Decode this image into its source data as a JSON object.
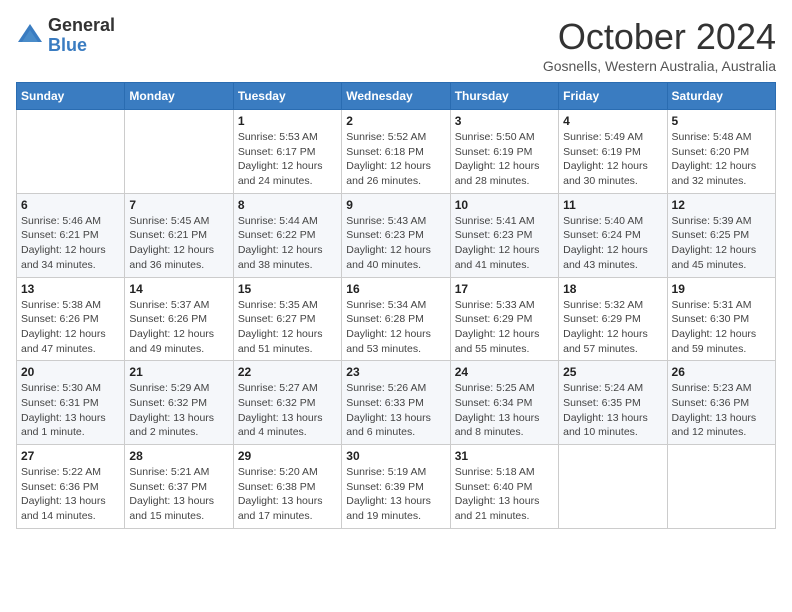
{
  "header": {
    "logo": {
      "general": "General",
      "blue": "Blue"
    },
    "title": "October 2024",
    "subtitle": "Gosnells, Western Australia, Australia"
  },
  "weekdays": [
    "Sunday",
    "Monday",
    "Tuesday",
    "Wednesday",
    "Thursday",
    "Friday",
    "Saturday"
  ],
  "weeks": [
    [
      {
        "day": "",
        "info": ""
      },
      {
        "day": "",
        "info": ""
      },
      {
        "day": "1",
        "info": "Sunrise: 5:53 AM\nSunset: 6:17 PM\nDaylight: 12 hours and 24 minutes."
      },
      {
        "day": "2",
        "info": "Sunrise: 5:52 AM\nSunset: 6:18 PM\nDaylight: 12 hours and 26 minutes."
      },
      {
        "day": "3",
        "info": "Sunrise: 5:50 AM\nSunset: 6:19 PM\nDaylight: 12 hours and 28 minutes."
      },
      {
        "day": "4",
        "info": "Sunrise: 5:49 AM\nSunset: 6:19 PM\nDaylight: 12 hours and 30 minutes."
      },
      {
        "day": "5",
        "info": "Sunrise: 5:48 AM\nSunset: 6:20 PM\nDaylight: 12 hours and 32 minutes."
      }
    ],
    [
      {
        "day": "6",
        "info": "Sunrise: 5:46 AM\nSunset: 6:21 PM\nDaylight: 12 hours and 34 minutes."
      },
      {
        "day": "7",
        "info": "Sunrise: 5:45 AM\nSunset: 6:21 PM\nDaylight: 12 hours and 36 minutes."
      },
      {
        "day": "8",
        "info": "Sunrise: 5:44 AM\nSunset: 6:22 PM\nDaylight: 12 hours and 38 minutes."
      },
      {
        "day": "9",
        "info": "Sunrise: 5:43 AM\nSunset: 6:23 PM\nDaylight: 12 hours and 40 minutes."
      },
      {
        "day": "10",
        "info": "Sunrise: 5:41 AM\nSunset: 6:23 PM\nDaylight: 12 hours and 41 minutes."
      },
      {
        "day": "11",
        "info": "Sunrise: 5:40 AM\nSunset: 6:24 PM\nDaylight: 12 hours and 43 minutes."
      },
      {
        "day": "12",
        "info": "Sunrise: 5:39 AM\nSunset: 6:25 PM\nDaylight: 12 hours and 45 minutes."
      }
    ],
    [
      {
        "day": "13",
        "info": "Sunrise: 5:38 AM\nSunset: 6:26 PM\nDaylight: 12 hours and 47 minutes."
      },
      {
        "day": "14",
        "info": "Sunrise: 5:37 AM\nSunset: 6:26 PM\nDaylight: 12 hours and 49 minutes."
      },
      {
        "day": "15",
        "info": "Sunrise: 5:35 AM\nSunset: 6:27 PM\nDaylight: 12 hours and 51 minutes."
      },
      {
        "day": "16",
        "info": "Sunrise: 5:34 AM\nSunset: 6:28 PM\nDaylight: 12 hours and 53 minutes."
      },
      {
        "day": "17",
        "info": "Sunrise: 5:33 AM\nSunset: 6:29 PM\nDaylight: 12 hours and 55 minutes."
      },
      {
        "day": "18",
        "info": "Sunrise: 5:32 AM\nSunset: 6:29 PM\nDaylight: 12 hours and 57 minutes."
      },
      {
        "day": "19",
        "info": "Sunrise: 5:31 AM\nSunset: 6:30 PM\nDaylight: 12 hours and 59 minutes."
      }
    ],
    [
      {
        "day": "20",
        "info": "Sunrise: 5:30 AM\nSunset: 6:31 PM\nDaylight: 13 hours and 1 minute."
      },
      {
        "day": "21",
        "info": "Sunrise: 5:29 AM\nSunset: 6:32 PM\nDaylight: 13 hours and 2 minutes."
      },
      {
        "day": "22",
        "info": "Sunrise: 5:27 AM\nSunset: 6:32 PM\nDaylight: 13 hours and 4 minutes."
      },
      {
        "day": "23",
        "info": "Sunrise: 5:26 AM\nSunset: 6:33 PM\nDaylight: 13 hours and 6 minutes."
      },
      {
        "day": "24",
        "info": "Sunrise: 5:25 AM\nSunset: 6:34 PM\nDaylight: 13 hours and 8 minutes."
      },
      {
        "day": "25",
        "info": "Sunrise: 5:24 AM\nSunset: 6:35 PM\nDaylight: 13 hours and 10 minutes."
      },
      {
        "day": "26",
        "info": "Sunrise: 5:23 AM\nSunset: 6:36 PM\nDaylight: 13 hours and 12 minutes."
      }
    ],
    [
      {
        "day": "27",
        "info": "Sunrise: 5:22 AM\nSunset: 6:36 PM\nDaylight: 13 hours and 14 minutes."
      },
      {
        "day": "28",
        "info": "Sunrise: 5:21 AM\nSunset: 6:37 PM\nDaylight: 13 hours and 15 minutes."
      },
      {
        "day": "29",
        "info": "Sunrise: 5:20 AM\nSunset: 6:38 PM\nDaylight: 13 hours and 17 minutes."
      },
      {
        "day": "30",
        "info": "Sunrise: 5:19 AM\nSunset: 6:39 PM\nDaylight: 13 hours and 19 minutes."
      },
      {
        "day": "31",
        "info": "Sunrise: 5:18 AM\nSunset: 6:40 PM\nDaylight: 13 hours and 21 minutes."
      },
      {
        "day": "",
        "info": ""
      },
      {
        "day": "",
        "info": ""
      }
    ]
  ]
}
